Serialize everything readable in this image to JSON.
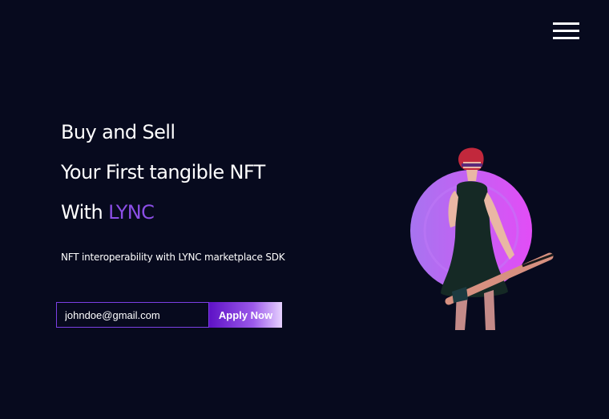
{
  "header": {
    "menu_icon": "hamburger-menu-icon"
  },
  "hero": {
    "line1": "Buy and Sell",
    "line2": "Your First tangible NFT",
    "line3_prefix": "With ",
    "line3_brand": "LYNC",
    "subtitle": "NFT interoperability with LYNC marketplace SDK",
    "email_value": "johndoe@gmail.com",
    "apply_label": "Apply Now"
  },
  "colors": {
    "background": "#070a1e",
    "brand_purple": "#8b4ee6",
    "circle_purple": "#a774f0",
    "circle_pink": "#e24df6"
  }
}
